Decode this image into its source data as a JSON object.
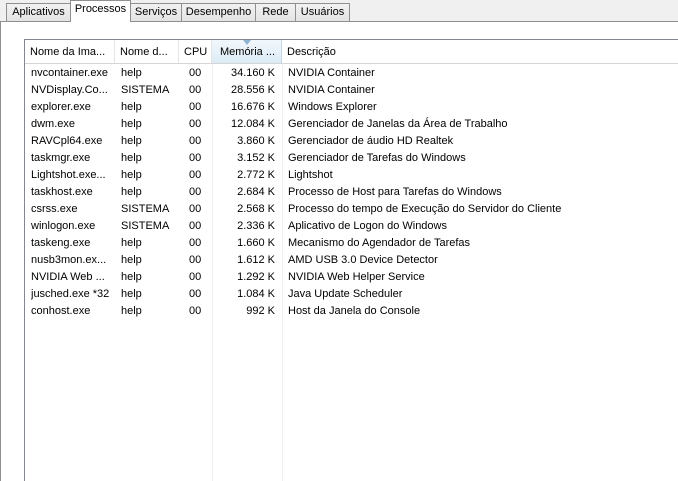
{
  "tabs": [
    {
      "label": "Aplicativos"
    },
    {
      "label": "Processos"
    },
    {
      "label": "Serviços"
    },
    {
      "label": "Desempenho"
    },
    {
      "label": "Rede"
    },
    {
      "label": "Usuários"
    }
  ],
  "columns": [
    {
      "label": "Nome da Ima..."
    },
    {
      "label": "Nome d..."
    },
    {
      "label": "CPU"
    },
    {
      "label": "Memória ..."
    },
    {
      "label": "Descrição"
    }
  ],
  "rows": [
    {
      "image": "nvcontainer.exe",
      "user": "help",
      "cpu": "00",
      "memory": "34.160 K",
      "description": "NVIDIA Container"
    },
    {
      "image": "NVDisplay.Co...",
      "user": "SISTEMA",
      "cpu": "00",
      "memory": "28.556 K",
      "description": "NVIDIA Container"
    },
    {
      "image": "explorer.exe",
      "user": "help",
      "cpu": "00",
      "memory": "16.676 K",
      "description": "Windows Explorer"
    },
    {
      "image": "dwm.exe",
      "user": "help",
      "cpu": "00",
      "memory": "12.084 K",
      "description": "Gerenciador de Janelas da Área de Trabalho"
    },
    {
      "image": "RAVCpl64.exe",
      "user": "help",
      "cpu": "00",
      "memory": "3.860 K",
      "description": "Gerenciador de áudio HD Realtek"
    },
    {
      "image": "taskmgr.exe",
      "user": "help",
      "cpu": "00",
      "memory": "3.152 K",
      "description": "Gerenciador de Tarefas do Windows"
    },
    {
      "image": "Lightshot.exe...",
      "user": "help",
      "cpu": "00",
      "memory": "2.772 K",
      "description": "Lightshot"
    },
    {
      "image": "taskhost.exe",
      "user": "help",
      "cpu": "00",
      "memory": "2.684 K",
      "description": "Processo de Host para Tarefas do Windows"
    },
    {
      "image": "csrss.exe",
      "user": "SISTEMA",
      "cpu": "00",
      "memory": "2.568 K",
      "description": "Processo do tempo de Execução do Servidor do Cliente"
    },
    {
      "image": "winlogon.exe",
      "user": "SISTEMA",
      "cpu": "00",
      "memory": "2.336 K",
      "description": "Aplicativo de Logon do Windows"
    },
    {
      "image": "taskeng.exe",
      "user": "help",
      "cpu": "00",
      "memory": "1.660 K",
      "description": "Mecanismo do Agendador de Tarefas"
    },
    {
      "image": "nusb3mon.ex...",
      "user": "help",
      "cpu": "00",
      "memory": "1.612 K",
      "description": "AMD USB 3.0 Device Detector"
    },
    {
      "image": "NVIDIA Web ...",
      "user": "help",
      "cpu": "00",
      "memory": "1.292 K",
      "description": "NVIDIA Web Helper Service"
    },
    {
      "image": "jusched.exe *32",
      "user": "help",
      "cpu": "00",
      "memory": "1.084 K",
      "description": "Java Update Scheduler"
    },
    {
      "image": "conhost.exe",
      "user": "help",
      "cpu": "00",
      "memory": "992 K",
      "description": "Host da Janela do Console"
    }
  ]
}
